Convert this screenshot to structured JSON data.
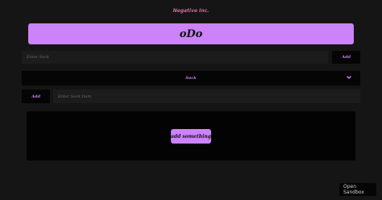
{
  "header": {
    "brand": "Negative Inc.",
    "app_title": "oDo"
  },
  "sock_form": {
    "input_placeholder": "Enter Sock",
    "add_label": "Add"
  },
  "sock_select": {
    "selected": "Sock",
    "chevron_icon": "chevron-down-icon"
  },
  "item_form": {
    "add_label": "Add",
    "input_placeholder": "Enter Sock Item"
  },
  "list": {
    "empty_button_label": "add something"
  },
  "sandbox": {
    "label": "Open Sandbox"
  },
  "colors": {
    "accent": "#cc82f8",
    "brand": "#c86a9a",
    "background": "#151515"
  }
}
